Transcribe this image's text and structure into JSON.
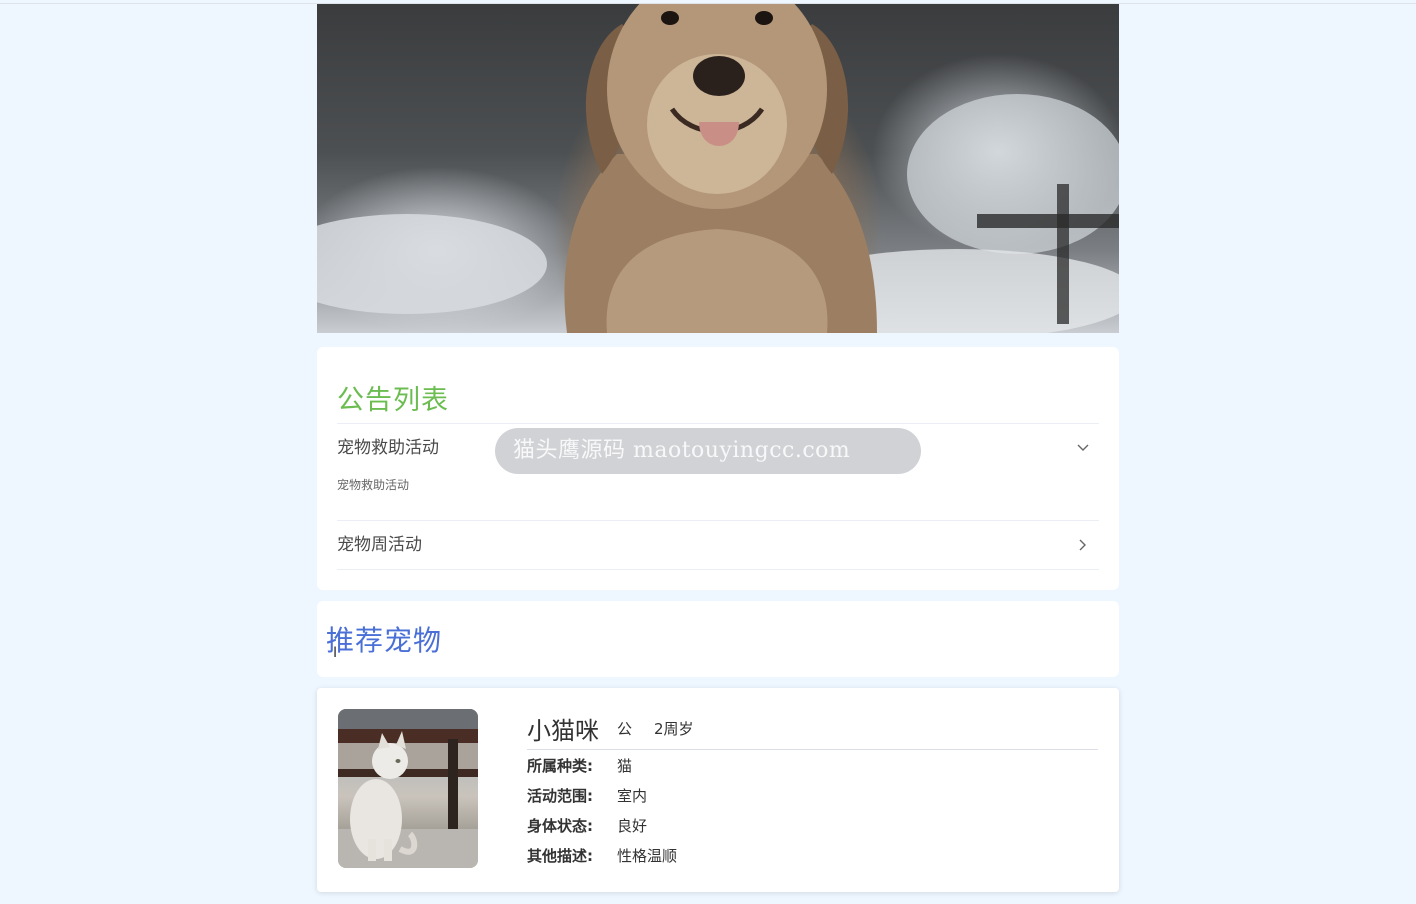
{
  "announcements": {
    "title": "公告列表",
    "items": [
      {
        "title": "宠物救助活动",
        "content": "宠物救助活动",
        "expanded": true
      },
      {
        "title": "宠物周活动",
        "content": "",
        "expanded": false
      }
    ]
  },
  "watermark": "猫头鹰源码 maotouyingcc.com",
  "recommend": {
    "title": "推荐宠物"
  },
  "pet": {
    "name": "小猫咪",
    "gender": "公",
    "age": "2周岁",
    "fields": [
      {
        "label": "所属种类:",
        "value": "猫"
      },
      {
        "label": "活动范围:",
        "value": "室内"
      },
      {
        "label": "身体状态:",
        "value": "良好"
      },
      {
        "label": "其他描述:",
        "value": "性格温顺"
      }
    ]
  }
}
